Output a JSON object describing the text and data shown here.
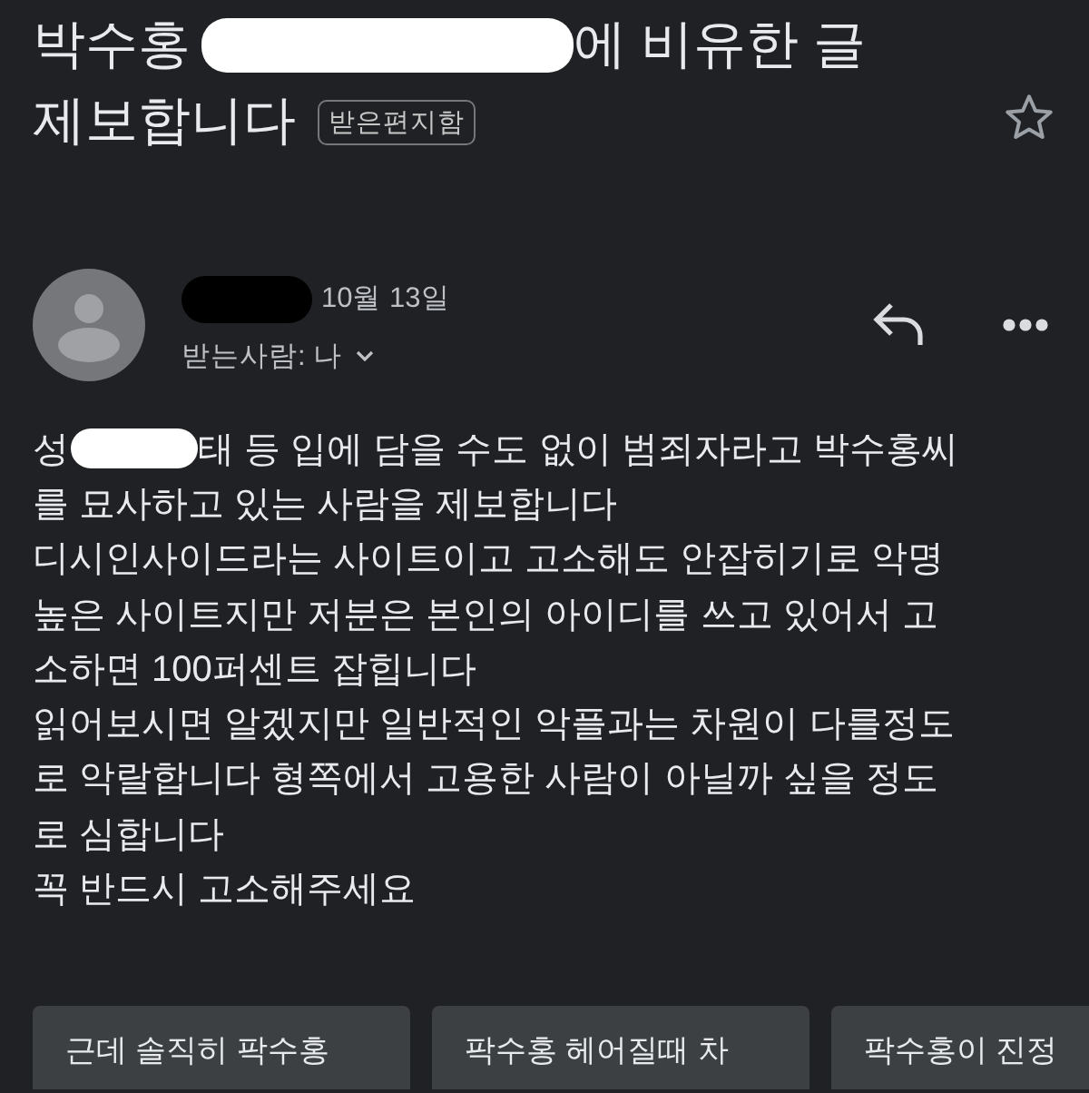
{
  "subject": {
    "lines": [
      [
        {
          "kind": "text",
          "text": "박수홍"
        },
        {
          "kind": "whiteout"
        },
        {
          "kind": "text",
          "text": "에 비유한 글"
        }
      ],
      [
        {
          "kind": "text",
          "text": "제보합니다"
        }
      ]
    ],
    "label": "받은편지함",
    "starred": false
  },
  "message": {
    "sender": {
      "kind": "blackout"
    },
    "date": "10월 13일",
    "recipient": "받는사람: 나",
    "body": [
      [
        {
          "kind": "text",
          "text": "성"
        },
        {
          "kind": "whiteout"
        },
        {
          "kind": "text",
          "text": "태 등 입에 담을 수도 없이 범죄자라고 박수홍씨"
        }
      ],
      [
        {
          "kind": "text",
          "text": "를 묘사하고 있는 사람을 제보합니다"
        }
      ],
      [
        {
          "kind": "text",
          "text": "디시인사이드라는 사이트이고 고소해도 안잡히기로 악명"
        }
      ],
      [
        {
          "kind": "text",
          "text": "높은 사이트지만 저분은 본인의 아이디를 쓰고 있어서 고"
        }
      ],
      [
        {
          "kind": "text",
          "text": "소하면 100퍼센트 잡힙니다"
        }
      ],
      [
        {
          "kind": "text",
          "text": "읽어보시면 알겠지만 일반적인 악플과는 차원이 다를정도"
        }
      ],
      [
        {
          "kind": "text",
          "text": "로 악랄합니다 형쪽에서 고용한 사람이 아닐까 싶을 정도"
        }
      ],
      [
        {
          "kind": "text",
          "text": "로 심합니다"
        }
      ],
      [
        {
          "kind": "text",
          "text": "꼭 반드시 고소해주세요"
        }
      ]
    ]
  },
  "smart_replies": [
    "근데 솔직히 팍수홍",
    "팍수홍 헤어질때 차",
    "팍수홍이 진정"
  ]
}
